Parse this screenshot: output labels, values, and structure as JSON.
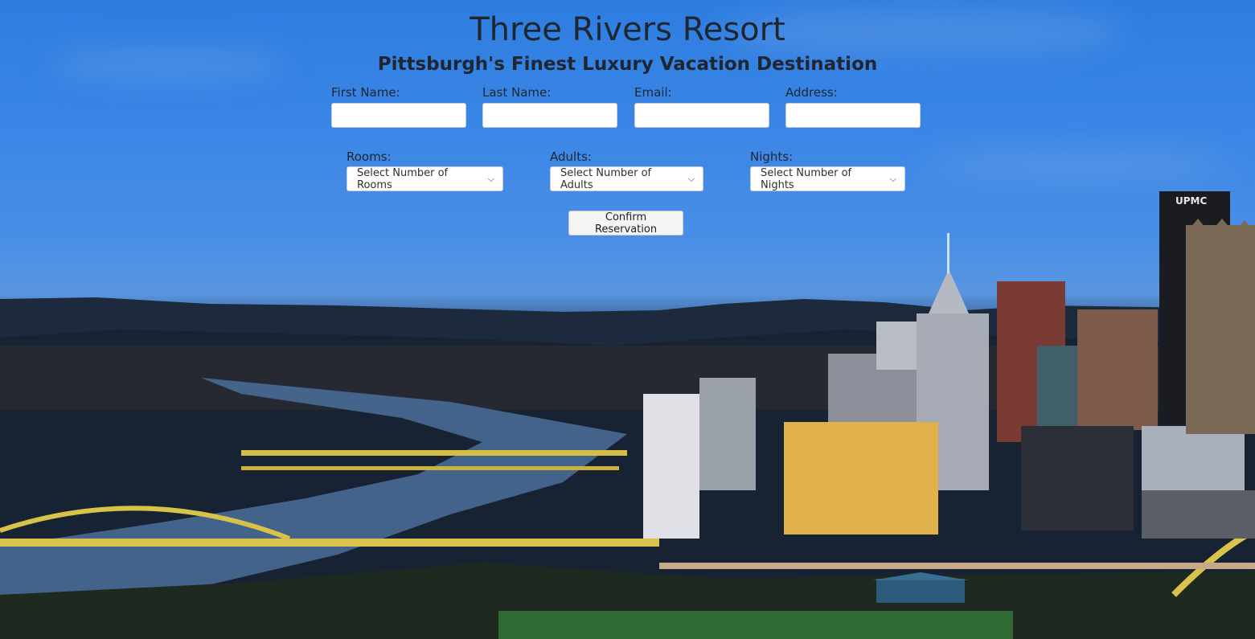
{
  "header": {
    "title": "Three Rivers Resort",
    "subtitle": "Pittsburgh's Finest Luxury Vacation Destination"
  },
  "form": {
    "fields": [
      {
        "label": "First Name:",
        "value": ""
      },
      {
        "label": "Last Name:",
        "value": ""
      },
      {
        "label": "Email:",
        "value": ""
      },
      {
        "label": "Address:",
        "value": ""
      }
    ],
    "selects": [
      {
        "label": "Rooms:",
        "selected": "Select Number of Rooms"
      },
      {
        "label": "Adults:",
        "selected": "Select Number of Adults"
      },
      {
        "label": "Nights:",
        "selected": "Select Number of Nights"
      }
    ],
    "confirm_label": "Confirm Reservation"
  },
  "background": {
    "sign_text": "UPMC",
    "sky_color": "#3a86e6"
  },
  "icons": {
    "dropdown": "chevron-down-icon"
  }
}
